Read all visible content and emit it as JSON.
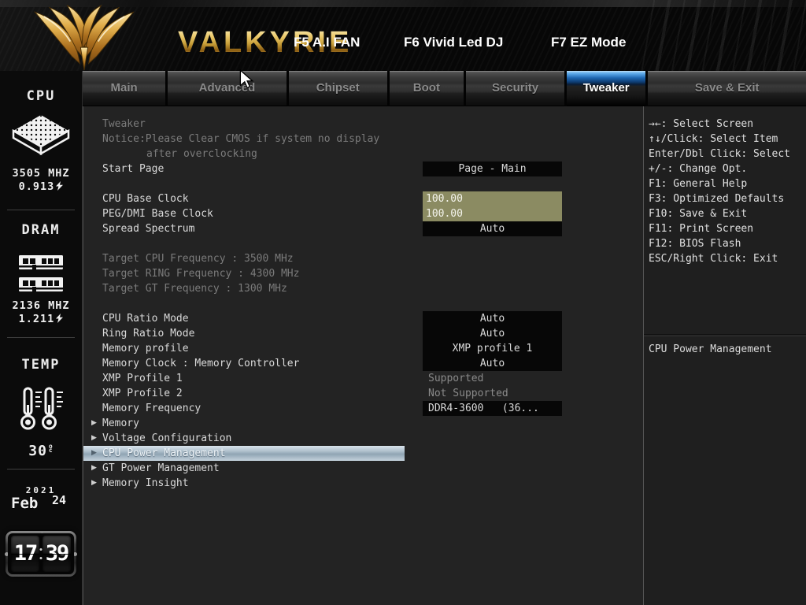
{
  "header": {
    "brand": "VALKYRIE",
    "shortcuts": [
      "F5 A.I FAN",
      "F6 Vivid Led DJ",
      "F7 EZ Mode"
    ]
  },
  "tabs": [
    {
      "label": "Main",
      "active": false
    },
    {
      "label": "Advanced",
      "active": false
    },
    {
      "label": "Chipset",
      "active": false
    },
    {
      "label": "Boot",
      "active": false
    },
    {
      "label": "Security",
      "active": false
    },
    {
      "label": "Tweaker",
      "active": true
    },
    {
      "label": "Save & Exit",
      "active": false
    }
  ],
  "sidebar": {
    "cpu_title": "CPU",
    "cpu_freq": "3505 MHZ",
    "cpu_volt": "0.913",
    "dram_title": "DRAM",
    "dram_freq": "2136 MHZ",
    "dram_volt": "1.211",
    "temp_title": "TEMP",
    "temp_value": "30",
    "temp_deg": "o",
    "temp_scale": "c",
    "date_year": "2021",
    "date_month": "Feb",
    "date_day": "24",
    "time_hour": "17",
    "time_minute": "39"
  },
  "main": {
    "rows": [
      {
        "type": "section",
        "label": "Tweaker"
      },
      {
        "type": "notice",
        "label": "Notice:Please Clear CMOS if system no display",
        "indent": 0
      },
      {
        "type": "notice",
        "label": "after overclocking",
        "indent": 1
      },
      {
        "type": "item",
        "label": "Start Page",
        "value": "Page - Main",
        "box": "black"
      },
      {
        "type": "blank"
      },
      {
        "type": "item",
        "label": "CPU Base Clock",
        "value": "100.00",
        "box": "olive"
      },
      {
        "type": "item",
        "label": "PEG/DMI Base Clock",
        "value": "100.00",
        "box": "olive"
      },
      {
        "type": "item",
        "label": "Spread Spectrum",
        "value": "Auto",
        "box": "black"
      },
      {
        "type": "blank"
      },
      {
        "type": "info",
        "label": "Target CPU Frequency : 3500 MHz"
      },
      {
        "type": "info",
        "label": "Target RING Frequency : 4300 MHz"
      },
      {
        "type": "info",
        "label": "Target GT Frequency : 1300 MHz"
      },
      {
        "type": "blank"
      },
      {
        "type": "item",
        "label": "CPU Ratio Mode",
        "value": "Auto",
        "box": "black"
      },
      {
        "type": "item",
        "label": "Ring Ratio Mode",
        "value": "Auto",
        "box": "black"
      },
      {
        "type": "item",
        "label": "Memory profile",
        "value": "XMP profile 1",
        "box": "black"
      },
      {
        "type": "item",
        "label": "Memory Clock : Memory Controller",
        "value": "Auto",
        "box": "black"
      },
      {
        "type": "infopair",
        "label": "XMP Profile 1",
        "value": "Supported"
      },
      {
        "type": "infopair",
        "label": "XMP Profile 2",
        "value": "Not Supported"
      },
      {
        "type": "item",
        "label": "Memory Frequency",
        "value": "DDR4-3600   (36...",
        "box": "black-left"
      },
      {
        "type": "submenu",
        "label": "Memory",
        "highlighted": false
      },
      {
        "type": "submenu",
        "label": "Voltage Configuration",
        "highlighted": false
      },
      {
        "type": "submenu",
        "label": "CPU Power Management",
        "highlighted": true
      },
      {
        "type": "submenu",
        "label": "GT Power Management",
        "highlighted": false
      },
      {
        "type": "submenu",
        "label": "Memory Insight",
        "highlighted": false
      }
    ]
  },
  "help": {
    "lines": [
      "→←: Select Screen",
      "↑↓/Click: Select Item",
      "Enter/Dbl Click: Select",
      "+/-: Change Opt.",
      "F1: General Help",
      "F3: Optimized Defaults",
      "F10: Save & Exit",
      "F11: Print Screen",
      "F12: BIOS Flash",
      "ESC/Right Click: Exit"
    ],
    "context_item": "CPU Power Management"
  },
  "colors": {
    "accent_blue": "#2f7fd0",
    "highlight_bar": "#a9bcc9",
    "olive_field": "#8b8b62",
    "gold": "#d9a43f"
  }
}
